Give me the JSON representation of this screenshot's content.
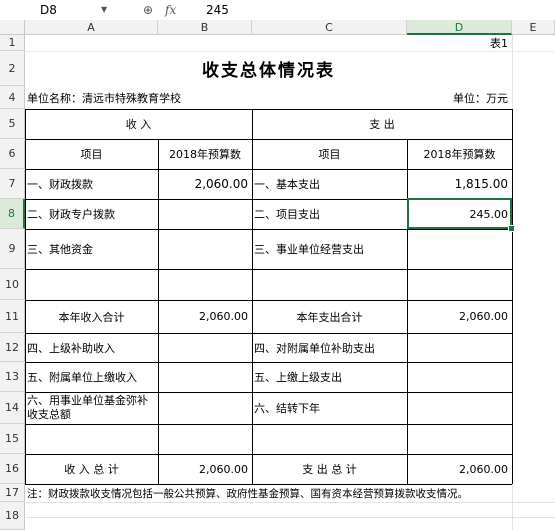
{
  "formula_bar": {
    "name_box": "D8",
    "fx_label": "fx",
    "value": "245"
  },
  "columns": [
    "A",
    "B",
    "C",
    "D",
    "E"
  ],
  "rows": [
    "1",
    "2",
    "4",
    "5",
    "6",
    "7",
    "8",
    "9",
    "10",
    "11",
    "12",
    "13",
    "14",
    "15",
    "16",
    "17",
    "18"
  ],
  "sheet": {
    "table_no": "表1",
    "title": "收支总体情况表",
    "unit_name": "单位名称：清远市特殊教育学校",
    "unit": "单位：万元",
    "income_header": "收      入",
    "expense_header": "支      出",
    "col_item": "项目",
    "col_budget": "2018年预算数",
    "income_items": [
      {
        "label": "一、财政拨款",
        "value": "2,060.00"
      },
      {
        "label": "二、财政专户拨款",
        "value": ""
      },
      {
        "label": "三、其他资金",
        "value": ""
      },
      {
        "label": "",
        "value": ""
      },
      {
        "label": "本年收入合计",
        "value": "2,060.00"
      },
      {
        "label": "四、上级补助收入",
        "value": ""
      },
      {
        "label": "五、附属单位上缴收入",
        "value": ""
      },
      {
        "label": "六、用事业单位基金弥补收支总额",
        "value": ""
      },
      {
        "label": "",
        "value": ""
      },
      {
        "label": "收 入 总 计",
        "value": "2,060.00"
      }
    ],
    "expense_items": [
      {
        "label": "一、基本支出",
        "value": "1,815.00"
      },
      {
        "label": "二、项目支出",
        "value": "245.00"
      },
      {
        "label": "三、事业单位经营支出",
        "value": ""
      },
      {
        "label": "",
        "value": ""
      },
      {
        "label": "本年支出合计",
        "value": "2,060.00"
      },
      {
        "label": "四、对附属单位补助支出",
        "value": ""
      },
      {
        "label": "五、上缴上级支出",
        "value": ""
      },
      {
        "label": "六、结转下年",
        "value": ""
      },
      {
        "label": "",
        "value": ""
      },
      {
        "label": "支 出 总 计",
        "value": "2,060.00"
      }
    ],
    "note": "注：财政拨款收支情况包括一般公共预算、政府性基金预算、国有资本经营预算拨款收支情况。"
  },
  "colors": {
    "selection": "#217346",
    "header_bg": "#f2f2f2"
  }
}
